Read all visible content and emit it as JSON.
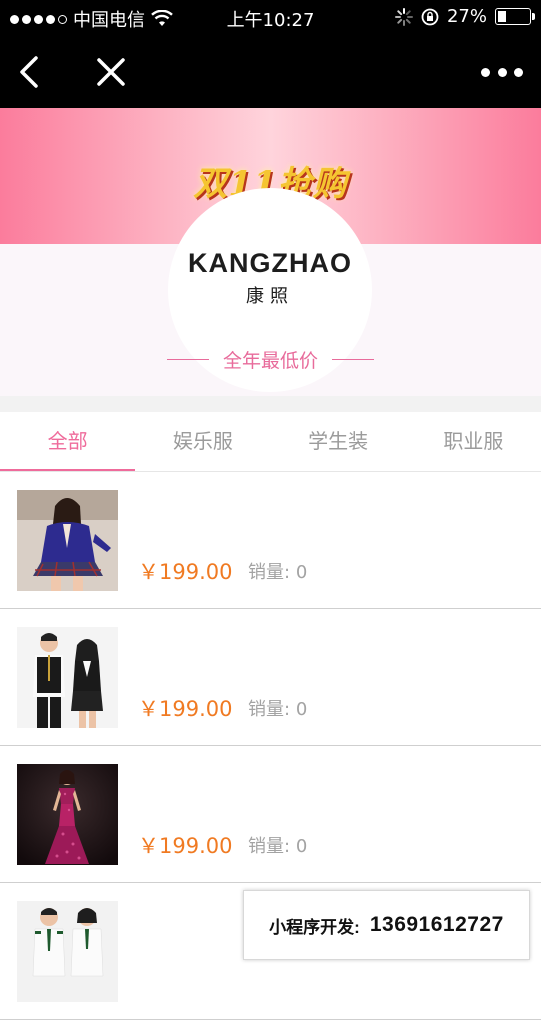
{
  "status_bar": {
    "carrier": "中国电信",
    "time": "上午10:27",
    "battery_text": "27%",
    "battery_level": 0.27,
    "icons": [
      "signal-dots-icon",
      "wifi-icon",
      "loading-spinner-icon",
      "orientation-lock-icon",
      "battery-icon"
    ]
  },
  "nav": {
    "icons": [
      "back-arrow-icon",
      "close-icon",
      "more-dots-icon"
    ]
  },
  "banner": {
    "title": "双11抢购",
    "logo_en": "KANGZHAO",
    "logo_cn": "康照",
    "slogan": "全年最低价"
  },
  "tabs": [
    {
      "label": "全部",
      "active": true
    },
    {
      "label": "娱乐服",
      "active": false
    },
    {
      "label": "学生装",
      "active": false
    },
    {
      "label": "职业服",
      "active": false
    }
  ],
  "products": [
    {
      "price": "￥199.00",
      "sales_label": "销量:",
      "sales_count": "0"
    },
    {
      "price": "￥199.00",
      "sales_label": "销量:",
      "sales_count": "0"
    },
    {
      "price": "￥199.00",
      "sales_label": "销量:",
      "sales_count": "0"
    },
    {
      "price": "",
      "sales_label": "",
      "sales_count": ""
    }
  ],
  "promo": {
    "label": "小程序开发:",
    "phone": "13691612727"
  },
  "colors": {
    "accent": "#ef6b9b",
    "price": "#f07a22",
    "banner_pink": "#fb7c9c"
  }
}
